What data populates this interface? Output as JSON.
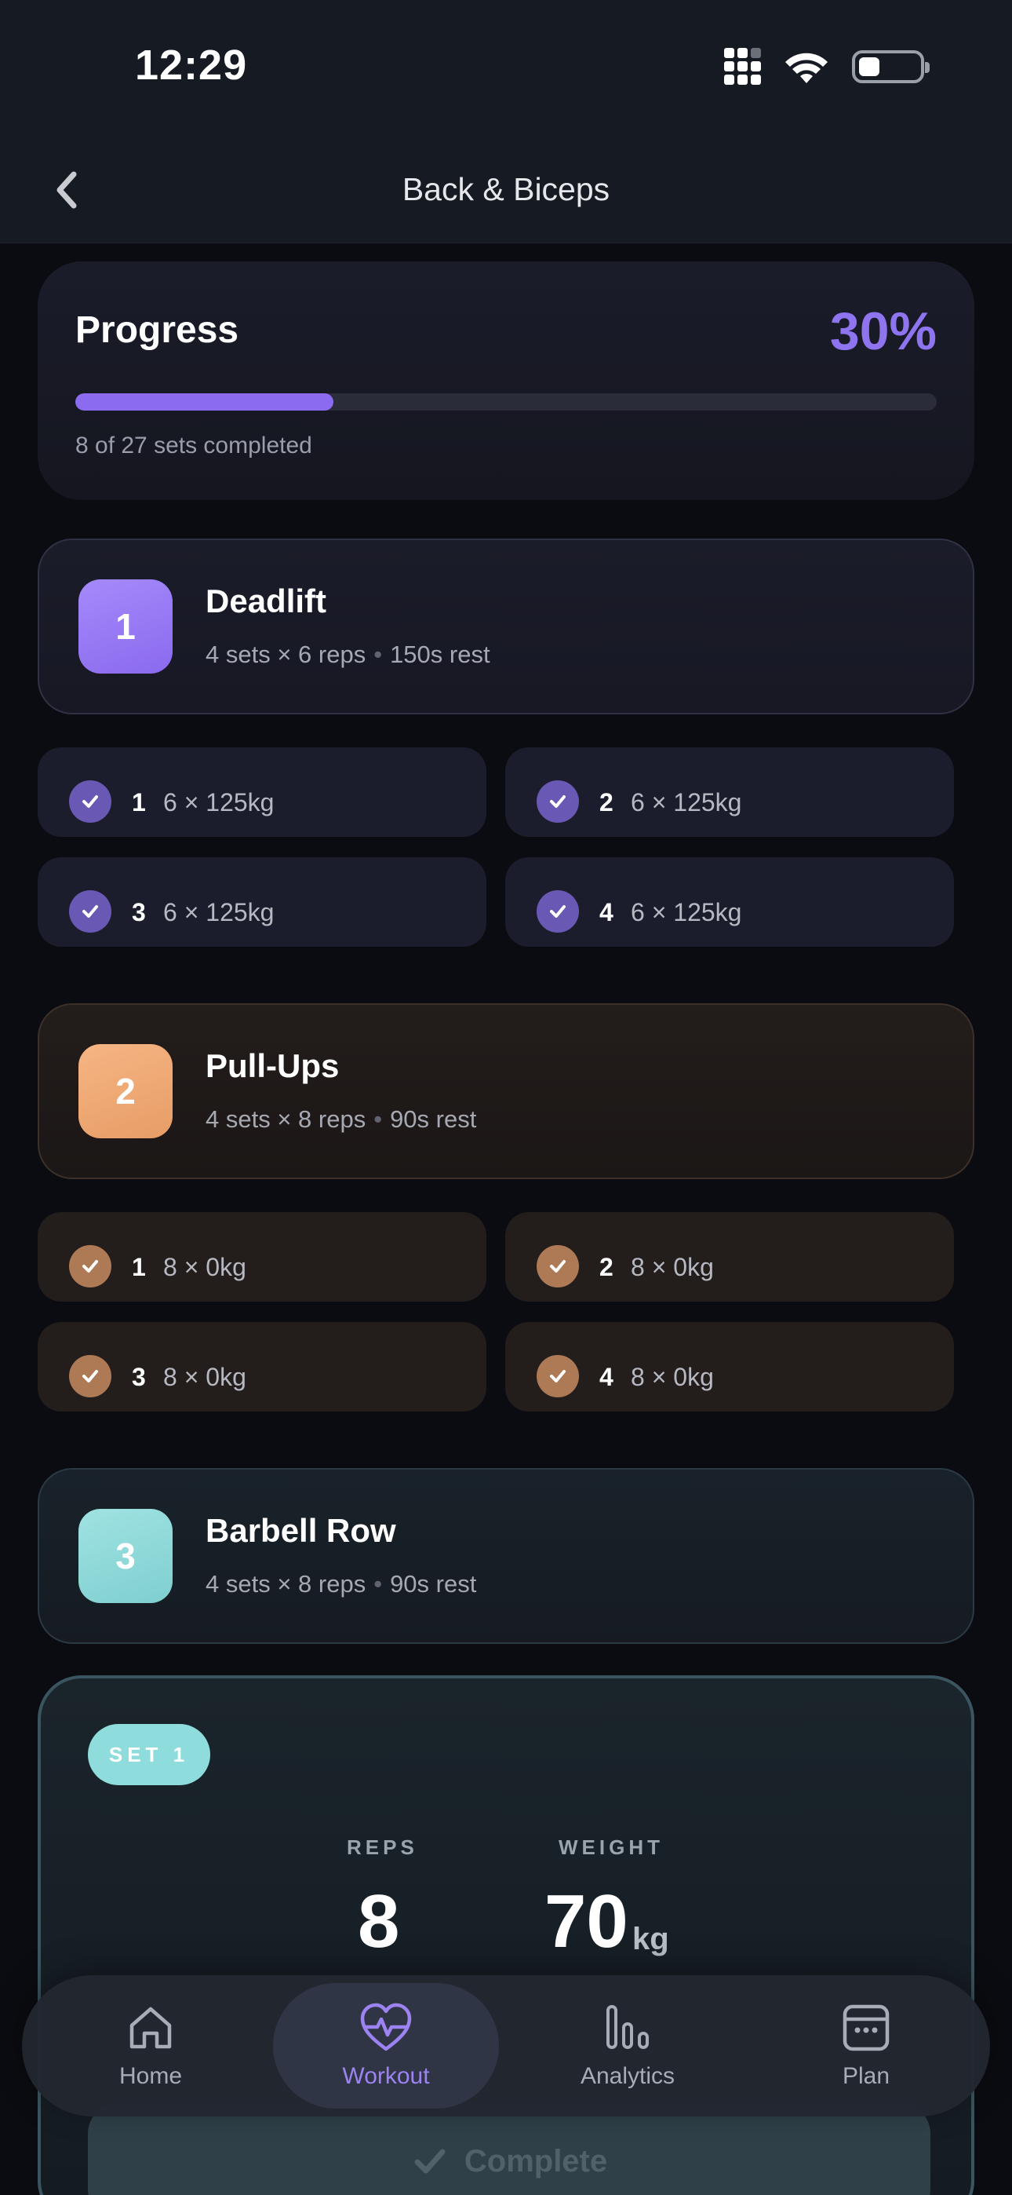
{
  "status_bar": {
    "time": "12:29"
  },
  "header": {
    "title": "Back & Biceps"
  },
  "progress": {
    "label": "Progress",
    "percent_text": "30%",
    "fraction": 0.3,
    "summary": "8 of 27 sets completed"
  },
  "exercises": [
    {
      "number": "1",
      "name": "Deadlift",
      "sets_reps": "4 sets × 6 reps",
      "rest": "150s rest",
      "theme": "purple",
      "sets": [
        {
          "num": "1",
          "value": "6 × 125kg"
        },
        {
          "num": "2",
          "value": "6 × 125kg"
        },
        {
          "num": "3",
          "value": "6 × 125kg"
        },
        {
          "num": "4",
          "value": "6 × 125kg"
        }
      ]
    },
    {
      "number": "2",
      "name": "Pull-Ups",
      "sets_reps": "4 sets × 8 reps",
      "rest": "90s rest",
      "theme": "orange",
      "sets": [
        {
          "num": "1",
          "value": "8 × 0kg"
        },
        {
          "num": "2",
          "value": "8 × 0kg"
        },
        {
          "num": "3",
          "value": "8 × 0kg"
        },
        {
          "num": "4",
          "value": "8 × 0kg"
        }
      ]
    },
    {
      "number": "3",
      "name": "Barbell Row",
      "sets_reps": "4 sets × 8 reps",
      "rest": "90s rest",
      "theme": "teal"
    }
  ],
  "active_set": {
    "badge": "SET 1",
    "reps_label": "REPS",
    "reps_value": "8",
    "weight_label": "WEIGHT",
    "weight_value": "70",
    "weight_unit": "kg",
    "complete_label": "Complete"
  },
  "tab_bar": {
    "tabs": [
      {
        "label": "Home",
        "icon": "home-icon"
      },
      {
        "label": "Workout",
        "icon": "heart-pulse-icon",
        "active": true
      },
      {
        "label": "Analytics",
        "icon": "bar-chart-icon"
      },
      {
        "label": "Plan",
        "icon": "calendar-icon"
      }
    ]
  },
  "colors": {
    "accent_purple": "#8b6cf0",
    "accent_orange": "#e9a06a",
    "accent_teal": "#8fdcdc",
    "background": "#0b0c11"
  }
}
